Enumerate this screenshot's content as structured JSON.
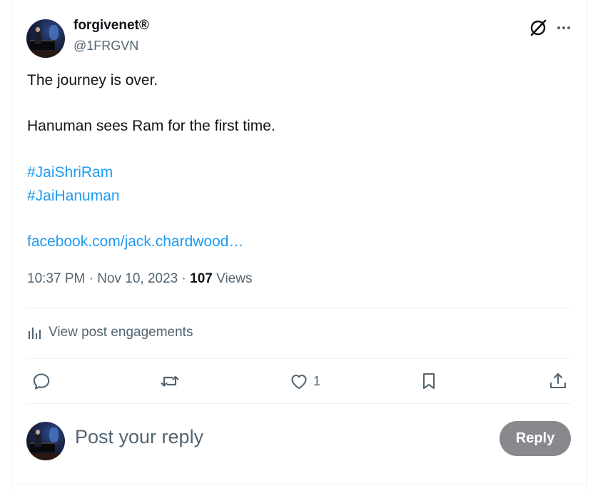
{
  "author": {
    "display_name": "forgivenet®",
    "handle": "@1FRGVN",
    "avatar": "avatar-pianist-photo"
  },
  "tweet": {
    "line1": "The journey is over.",
    "line2": "Hanuman sees Ram for the first time.",
    "hashtag1": "#JaiShriRam",
    "hashtag2": "#JaiHanuman",
    "link": "facebook.com/jack.chardwood…"
  },
  "meta": {
    "time": "10:37 PM",
    "separator1": " · ",
    "date": "Nov 10, 2023",
    "separator2": " · ",
    "views_count": "107",
    "views_label": " Views"
  },
  "engagements": {
    "label": "View post engagements",
    "icon": "bar-chart-icon"
  },
  "actions": {
    "reply_icon": "reply-icon",
    "repost_icon": "repost-icon",
    "like_icon": "heart-icon",
    "like_count": "1",
    "bookmark_icon": "bookmark-icon",
    "share_icon": "share-icon"
  },
  "reply_box": {
    "placeholder": "Post your reply",
    "button_label": "Reply"
  },
  "header_icons": {
    "grok": "grok-icon",
    "more": "more-icon"
  },
  "colors": {
    "text_primary": "#0f1419",
    "text_secondary": "#536471",
    "link": "#1d9bf0",
    "reply_button_disabled": "#87898c",
    "divider": "#eff3f4"
  }
}
